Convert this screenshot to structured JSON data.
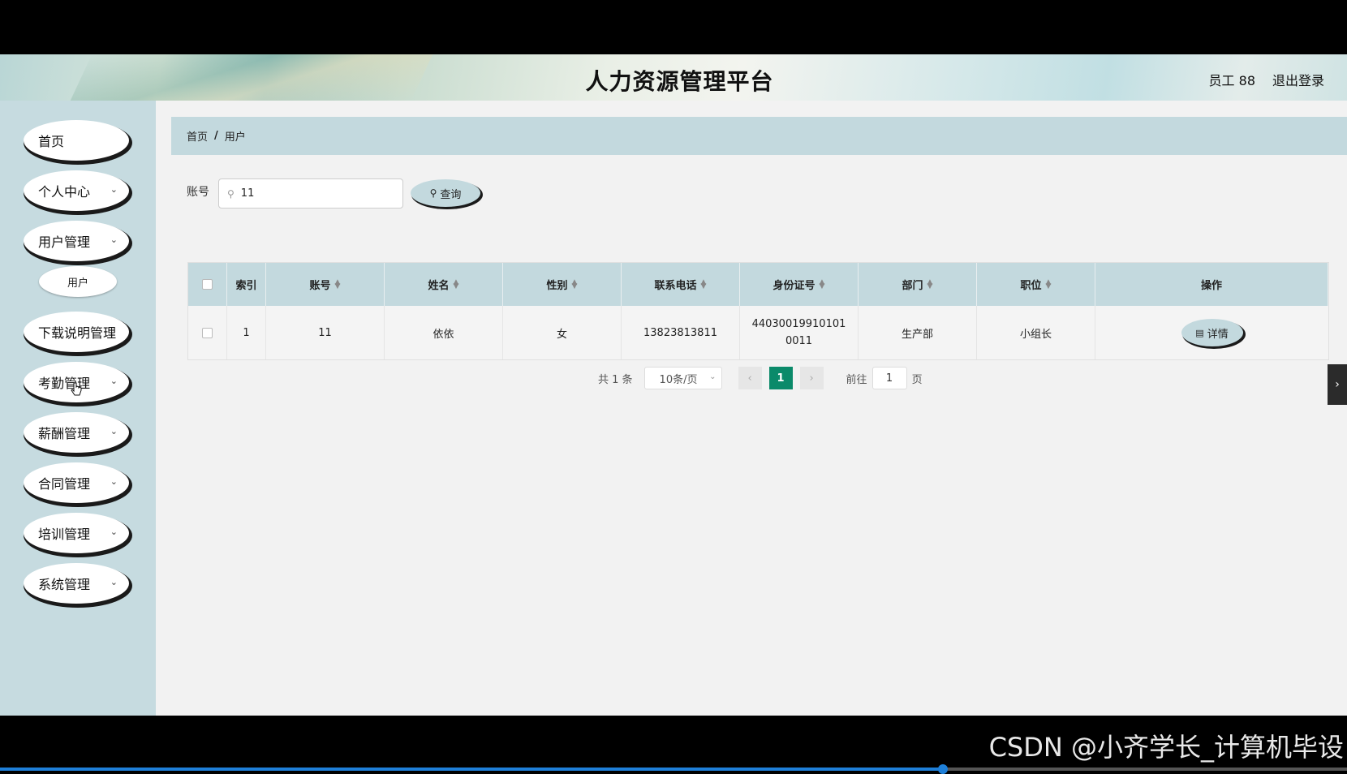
{
  "header": {
    "title": "人力资源管理平台",
    "user": "员工 88",
    "logout": "退出登录"
  },
  "sidebar": {
    "items": [
      {
        "label": "首页",
        "has_arrow": false
      },
      {
        "label": "个人中心",
        "has_arrow": true
      },
      {
        "label": "用户管理",
        "has_arrow": true
      },
      {
        "label": "下载说明管理",
        "has_arrow": false
      },
      {
        "label": "考勤管理",
        "has_arrow": true
      },
      {
        "label": "薪酬管理",
        "has_arrow": true
      },
      {
        "label": "合同管理",
        "has_arrow": true
      },
      {
        "label": "培训管理",
        "has_arrow": true
      },
      {
        "label": "系统管理",
        "has_arrow": true
      }
    ],
    "sub_item": "用户"
  },
  "breadcrumb": {
    "home": "首页",
    "separator": "/",
    "current": "用户"
  },
  "search": {
    "label": "账号",
    "value": "11",
    "button": "查询"
  },
  "table": {
    "columns": [
      "索引",
      "账号",
      "姓名",
      "性别",
      "联系电话",
      "身份证号",
      "部门",
      "职位",
      "操作"
    ],
    "rows": [
      {
        "index": "1",
        "account": "11",
        "name": "依依",
        "gender": "女",
        "phone": "13823813811",
        "id_card": "440300199101010011",
        "dept": "生产部",
        "position": "小组长",
        "action": "详情"
      }
    ]
  },
  "pagination": {
    "total": "共 1 条",
    "page_size": "10条/页",
    "current_page": "1",
    "goto_label": "前往",
    "goto_value": "1",
    "page_unit": "页"
  },
  "watermark": "CSDN @小齐学长_计算机毕设",
  "video_progress": 0.7,
  "colors": {
    "accent": "#c3d9de",
    "sidebar_bg": "#c6dbe0",
    "page_active": "#0b8a6a"
  }
}
